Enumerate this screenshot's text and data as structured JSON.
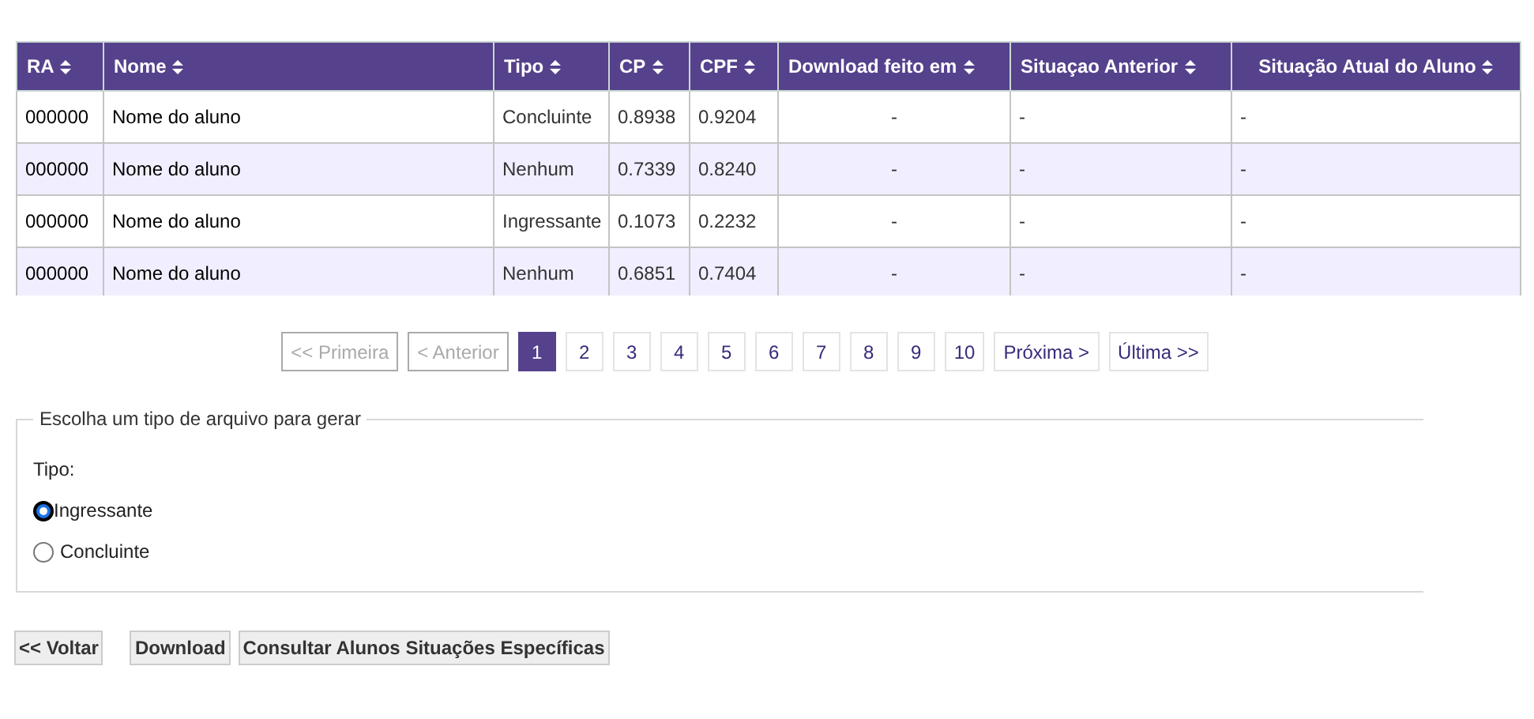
{
  "table": {
    "columns": [
      "RA",
      "Nome",
      "Tipo",
      "CP",
      "CPF",
      "Download feito em",
      "Situaçao Anterior",
      "Situação Atual do Aluno"
    ],
    "rows": [
      [
        "000000",
        "Nome do aluno",
        "Concluinte",
        "0.8938",
        "0.9204",
        "-",
        "-",
        "-"
      ],
      [
        "000000",
        "Nome do aluno",
        "Nenhum",
        "0.7339",
        "0.8240",
        "-",
        "-",
        "-"
      ],
      [
        "000000",
        "Nome do aluno",
        "Ingressante",
        "0.1073",
        "0.2232",
        "-",
        "-",
        "-"
      ],
      [
        "000000",
        "Nome do aluno",
        "Nenhum",
        "0.6851",
        "0.7404",
        "-",
        "-",
        "-"
      ]
    ]
  },
  "pagination": [
    {
      "label": "<< Primeira",
      "disabled": true,
      "selected": false
    },
    {
      "label": "< Anterior",
      "disabled": true,
      "selected": false
    },
    {
      "label": "1",
      "disabled": false,
      "selected": true
    },
    {
      "label": "2",
      "disabled": false,
      "selected": false
    },
    {
      "label": "3",
      "disabled": false,
      "selected": false
    },
    {
      "label": "4",
      "disabled": false,
      "selected": false
    },
    {
      "label": "5",
      "disabled": false,
      "selected": false
    },
    {
      "label": "6",
      "disabled": false,
      "selected": false
    },
    {
      "label": "7",
      "disabled": false,
      "selected": false
    },
    {
      "label": "8",
      "disabled": false,
      "selected": false
    },
    {
      "label": "9",
      "disabled": false,
      "selected": false
    },
    {
      "label": "10",
      "disabled": false,
      "selected": false
    },
    {
      "label": "Próxima >",
      "disabled": false,
      "selected": false
    },
    {
      "label": "Última >>",
      "disabled": false,
      "selected": false
    }
  ],
  "file_type": {
    "legend": "Escolha um tipo de arquivo para gerar",
    "label": "Tipo:",
    "options": [
      {
        "label": "Ingressante",
        "selected": true
      },
      {
        "label": "Concluinte",
        "selected": false
      }
    ]
  },
  "buttons": [
    "<< Voltar",
    "Download",
    "Consultar Alunos Situações Específicas"
  ]
}
